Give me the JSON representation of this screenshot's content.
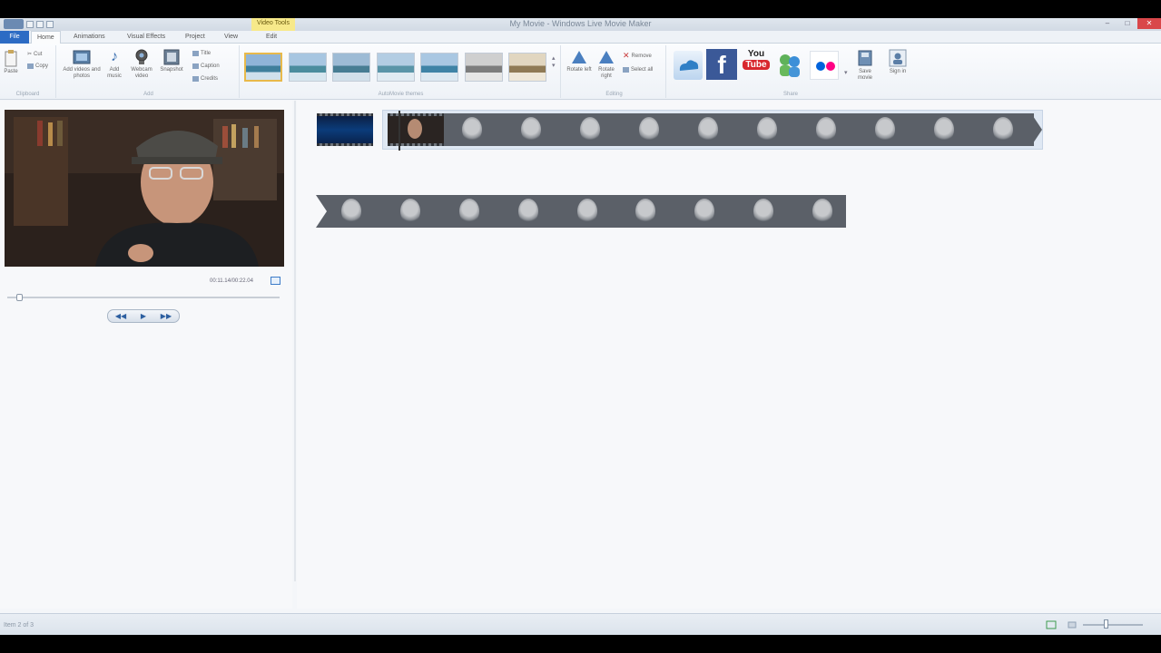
{
  "window": {
    "title": "My Movie - Windows Live Movie Maker",
    "contextual_tab": "Video Tools",
    "minimize": "–",
    "maximize": "□",
    "close": "✕"
  },
  "tabs": [
    {
      "label": "File"
    },
    {
      "label": "Home"
    },
    {
      "label": "Animations"
    },
    {
      "label": "Visual Effects"
    },
    {
      "label": "Project"
    },
    {
      "label": "View"
    },
    {
      "label": "Edit"
    }
  ],
  "ribbon": {
    "clipboard": {
      "label": "Clipboard",
      "paste": "Paste",
      "cut": "Cut",
      "copy": "Copy"
    },
    "add": {
      "label": "Add",
      "add_videos": "Add videos and photos",
      "add_music": "Add music",
      "webcam": "Webcam video",
      "snapshot": "Snapshot",
      "title": "Title",
      "caption": "Caption",
      "credits": "Credits"
    },
    "automovie": {
      "label": "AutoMovie themes"
    },
    "editing": {
      "label": "Editing",
      "rotate_left": "Rotate left",
      "rotate_right": "Rotate right",
      "remove": "Remove",
      "select_all": "Select all"
    },
    "share": {
      "label": "Share",
      "save_movie": "Save movie",
      "sign_in": "Sign in"
    }
  },
  "preview": {
    "timecode": "00:11.14/00:22.04"
  },
  "playback": {
    "prev": "◀◀",
    "play": "▶",
    "next": "▶▶"
  },
  "status": {
    "item": "Item 2 of 3"
  },
  "colors": {
    "file_tab": "#2c6bc4",
    "accent": "#3d7cc8",
    "close": "#d9474a"
  }
}
